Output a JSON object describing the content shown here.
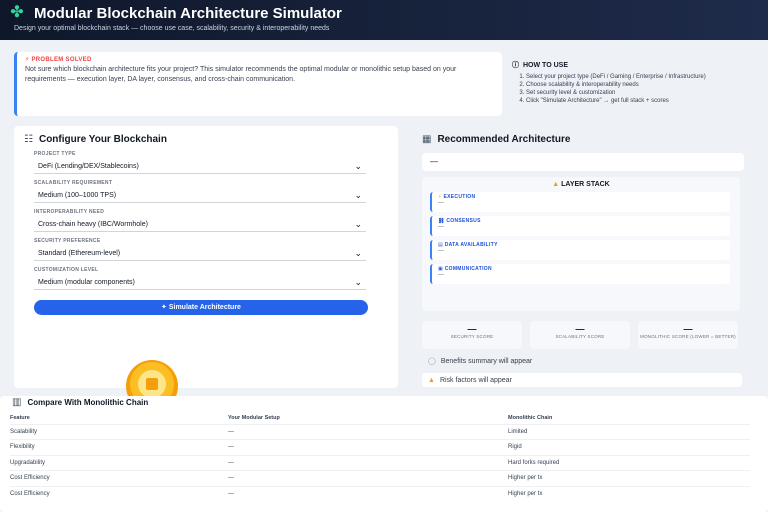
{
  "header": {
    "title": "Modular Blockchain Architecture Simulator",
    "subtitle": "Design your optimal blockchain stack — choose use case, scalability, security & interoperability needs"
  },
  "banner": {
    "label": "PROBLEM SOLVED",
    "text": "Not sure which blockchain architecture fits your project? This simulator recommends the optimal modular or monolithic setup based on your requirements — execution layer, DA layer, consensus, and cross-chain communication."
  },
  "howto": {
    "title": "HOW TO USE",
    "steps": [
      "Select your project type (DeFi / Gaming / Enterprise / Infrastructure)",
      "Choose scalability & interoperability needs",
      "Set security level & customization",
      "Click \"Simulate Architecture\" → get full stack + scores"
    ]
  },
  "config": {
    "title": "Configure Your Blockchain",
    "fields": [
      {
        "label": "PROJECT TYPE",
        "value": "DeFi (Lending/DEX/Stablecoins)"
      },
      {
        "label": "SCALABILITY REQUIREMENT",
        "value": "Medium (100–1000 TPS)"
      },
      {
        "label": "INTEROPERABILITY NEED",
        "value": "Cross-chain heavy (IBC/Wormhole)"
      },
      {
        "label": "SECURITY PREFERENCE",
        "value": "Standard (Ethereum-level)"
      },
      {
        "label": "CUSTOMIZATION LEVEL",
        "value": "Medium (modular components)"
      }
    ],
    "button": "Simulate Architecture"
  },
  "reco": {
    "title": "Recommended Architecture",
    "value": "—",
    "stack_title": "LAYER STACK",
    "layers": [
      {
        "name": "EXECUTION",
        "value": "—"
      },
      {
        "name": "CONSENSUS",
        "value": "—"
      },
      {
        "name": "DATA AVAILABILITY",
        "value": "—"
      },
      {
        "name": "COMMUNICATION",
        "value": "—"
      }
    ],
    "scores": [
      {
        "value": "—",
        "label": "SECURITY SCORE"
      },
      {
        "value": "—",
        "label": "SCALABILITY SCORE"
      },
      {
        "value": "—",
        "label": "MONOLITHIC SCORE (LOWER = BETTER)"
      }
    ],
    "benefits": "Benefits summary will appear",
    "risks": "Risk factors will appear"
  },
  "compare": {
    "title": "Compare With Monolithic Chain",
    "headers": [
      "Feature",
      "Your Modular Setup",
      "Monolithic Chain"
    ],
    "rows": [
      [
        "Scalability",
        "—",
        "Limited"
      ],
      [
        "Flexibility",
        "—",
        "Rigid"
      ],
      [
        "Upgradability",
        "—",
        "Hard forks required"
      ],
      [
        "Cost Efficiency",
        "—",
        "Higher per tx"
      ],
      [
        "Cost Efficiency",
        "—",
        "Higher per tx"
      ]
    ]
  }
}
